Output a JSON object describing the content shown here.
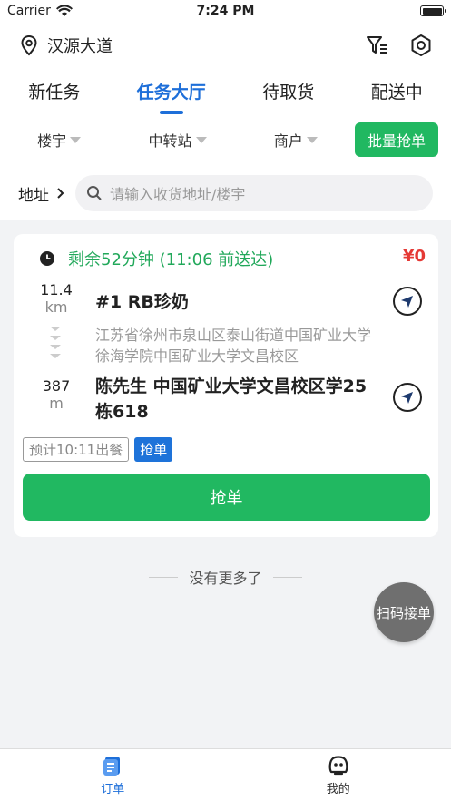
{
  "status": {
    "carrier": "Carrier",
    "time": "7:24 PM"
  },
  "header": {
    "location": "汉源大道"
  },
  "tabs": [
    "新任务",
    "任务大厅",
    "待取货",
    "配送中"
  ],
  "filters": {
    "building": "楼宇",
    "transfer": "中转站",
    "merchant": "商户",
    "batch": "批量抢单"
  },
  "search": {
    "address_label": "地址",
    "placeholder": "请输入收货地址/楼宇"
  },
  "order": {
    "remaining": "剩余52分钟 (11:06 前送达)",
    "price": "¥0",
    "shop_distance": "11.4",
    "shop_unit": "km",
    "shop_name": "#1 RB珍奶",
    "shop_address": "江苏省徐州市泉山区泰山街道中国矿业大学徐海学院中国矿业大学文昌校区",
    "customer_distance": "387",
    "customer_unit": "m",
    "customer": "陈先生 中国矿业大学文昌校区学25栋618",
    "estimate_tag": "预计10:11出餐",
    "grab_tag": "抢单",
    "grab_button": "抢单"
  },
  "list": {
    "no_more": "没有更多了"
  },
  "scan_button": "扫码接单",
  "tabbar": {
    "orders": "订单",
    "mine": "我的"
  },
  "colors": {
    "primary": "#1e6fd9",
    "green": "#21b861",
    "red": "#e53935"
  }
}
